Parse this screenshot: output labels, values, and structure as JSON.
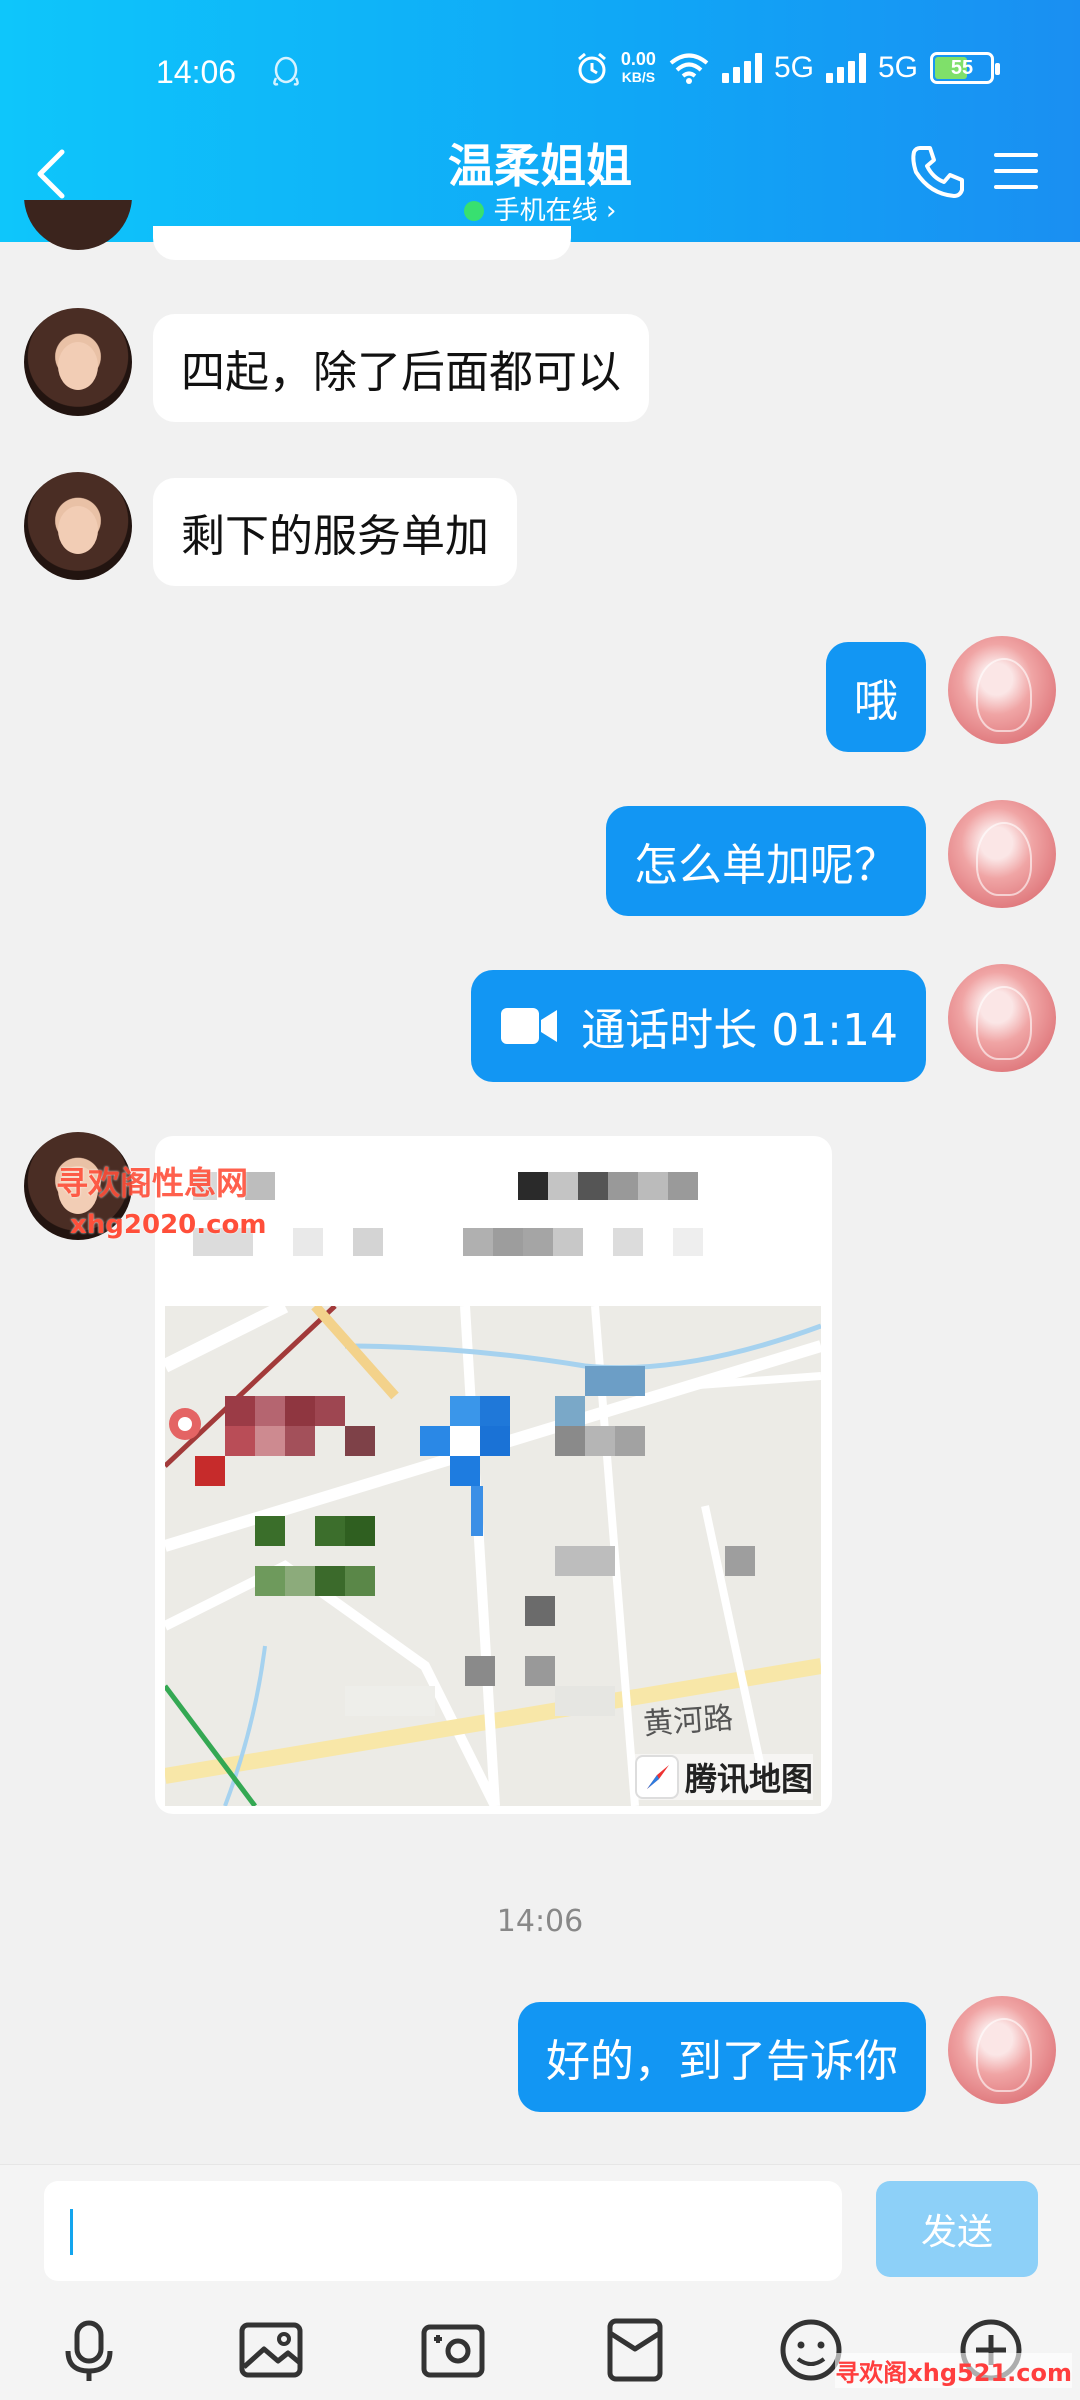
{
  "status_bar": {
    "time": "14:06",
    "net_speed_value": "0.00",
    "net_speed_unit": "KB/S",
    "network_1": "5G",
    "network_2": "5G",
    "battery": "55"
  },
  "header": {
    "title": "温柔姐姐",
    "subtitle": "手机在线",
    "subtitle_chevron": "›"
  },
  "messages": [
    {
      "side": "in",
      "text": "四起，除了后面都可以"
    },
    {
      "side": "in",
      "text": "剩下的服务单加"
    },
    {
      "side": "out",
      "text": "哦"
    },
    {
      "side": "out",
      "text": "怎么单加呢？"
    },
    {
      "side": "out",
      "type": "call",
      "text": "通话时长 01:14"
    },
    {
      "side": "in",
      "type": "location",
      "map_brand": "腾讯地图",
      "road_label": "黄河路"
    },
    {
      "side": "out",
      "text": "好的，到了告诉你"
    }
  ],
  "timestamp": "14:06",
  "watermarks": {
    "line1": "寻欢阁性息网",
    "line2": "xhg2020.com",
    "corner": "寻欢阁xhg521.com"
  },
  "input": {
    "value": "",
    "send_label": "发送"
  },
  "colors": {
    "header_start": "#0ec6fb",
    "header_end": "#1a8ff2",
    "bubble_out": "#1296f3",
    "bubble_in": "#ffffff",
    "send_disabled": "#8dd0f8"
  },
  "toolbar": [
    "microphone-icon",
    "image-icon",
    "camera-icon",
    "red-packet-icon",
    "emoji-icon",
    "plus-icon"
  ]
}
